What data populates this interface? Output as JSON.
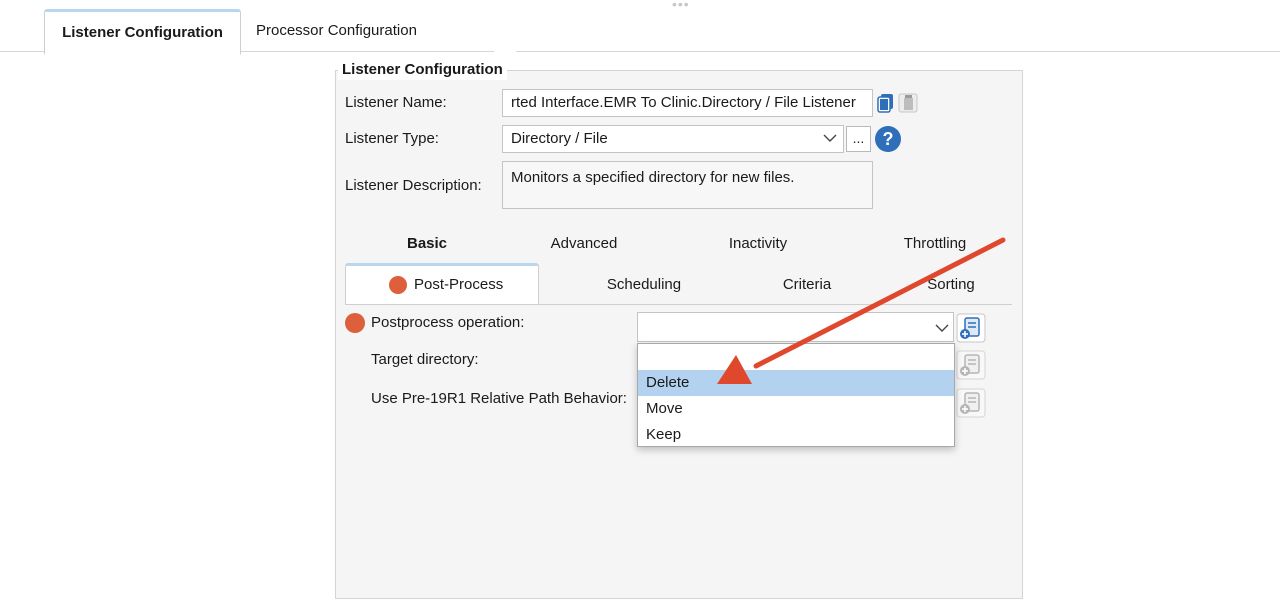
{
  "tabs": [
    {
      "label": "Listener Configuration",
      "active": true
    },
    {
      "label": "Processor Configuration",
      "active": false
    }
  ],
  "group_title": "Listener Configuration",
  "listener": {
    "name_label": "Listener Name:",
    "name_value": "rted Interface.EMR To Clinic.Directory / File Listener",
    "type_label": "Listener Type:",
    "type_value": "Directory / File",
    "more_button": "...",
    "help_glyph": "?",
    "desc_label": "Listener Description:",
    "desc_value": "Monitors a specified directory for new files."
  },
  "section_tabs": [
    "Basic",
    "Advanced",
    "Inactivity",
    "Throttling"
  ],
  "sub_tabs": [
    "Post-Process",
    "Scheduling",
    "Criteria",
    "Sorting"
  ],
  "postprocess": {
    "operation_label": "Postprocess operation:",
    "operation_value": "",
    "target_label": "Target directory:",
    "legacy_label": "Use Pre-19R1 Relative Path Behavior:",
    "options": [
      "",
      "Delete",
      "Move",
      "Keep"
    ],
    "highlighted_option": "Delete"
  },
  "colors": {
    "accent_tab": "#b9d6ef",
    "required_dot": "#dd5f3c",
    "selection": "#b3d2ef",
    "annotation_arrow": "#e0482e",
    "help": "#2f6fba"
  },
  "icons": {
    "copy": "copy-icon",
    "paste": "paste-icon",
    "help": "help-icon",
    "add_variable": "add-variable-icon"
  }
}
